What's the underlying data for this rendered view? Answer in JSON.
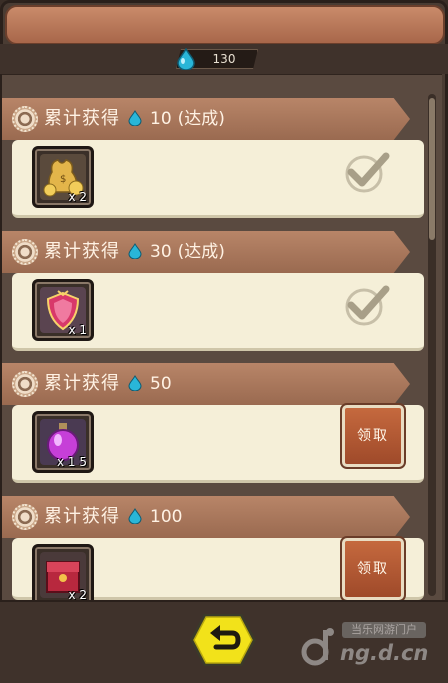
{
  "currency": {
    "icon": "blue-droplet-icon",
    "value": "130"
  },
  "rewards": [
    {
      "label": "累计获得",
      "icon": "blue-droplet-icon",
      "threshold": "10",
      "status": "(达成)",
      "item_icon": "gold-coin-bag-icon",
      "qty": "x 2",
      "state": "claimed"
    },
    {
      "label": "累计获得",
      "icon": "blue-droplet-icon",
      "threshold": "30",
      "status": "(达成)",
      "item_icon": "pink-crest-shield-icon",
      "qty": "x 1",
      "state": "claimed"
    },
    {
      "label": "累计获得",
      "icon": "blue-droplet-icon",
      "threshold": "50",
      "status": "",
      "item_icon": "purple-potion-icon",
      "qty": "x 1 5",
      "state": "claimable",
      "button_label": "领取"
    },
    {
      "label": "累计获得",
      "icon": "blue-droplet-icon",
      "threshold": "100",
      "status": "",
      "item_icon": "red-treasure-chest-icon",
      "qty": "x 2",
      "state": "claimable",
      "button_label": "领取"
    }
  ],
  "back_button": {
    "icon": "back-arrow-icon"
  },
  "watermark": {
    "top_text": "当乐网游门户",
    "url_text": "ng.d.cn"
  },
  "colors": {
    "panel_brown": "#4a3c33",
    "header_tan": "#b88568",
    "body_cream": "#f5efd8",
    "claim_orange": "#c5693e",
    "back_yellow": "#f2e21a"
  }
}
